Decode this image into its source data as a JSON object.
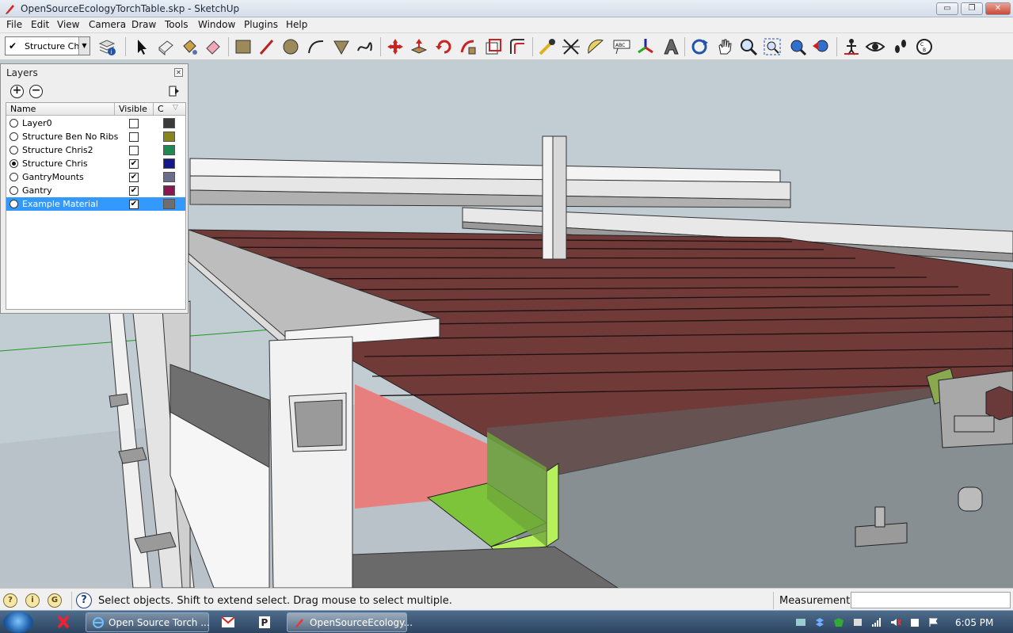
{
  "window": {
    "title": "OpenSourceEcologyTorchTable.skp - SketchUp",
    "minimize_label": "▭",
    "restore_label": "❐",
    "close_label": "✕"
  },
  "menu": [
    "File",
    "Edit",
    "View",
    "Camera",
    "Draw",
    "Tools",
    "Window",
    "Plugins",
    "Help"
  ],
  "toolbar": {
    "layer_dropdown_value": "Structure Chris",
    "layer_check": "✔",
    "tools": [
      "layer-manager-icon",
      "select-icon",
      "make-component-icon",
      "paint-bucket-icon",
      "eraser-icon",
      "rectangle-icon",
      "line-icon",
      "circle-icon",
      "arc-icon",
      "polygon-icon",
      "freehand-icon",
      "move-icon",
      "push-pull-icon",
      "rotate-icon",
      "follow-me-icon",
      "scale-icon",
      "offset-icon",
      "tape-measure-icon",
      "dimension-icon",
      "protractor-icon",
      "text-icon",
      "axes-icon",
      "3d-text-icon",
      "orbit-icon",
      "pan-icon",
      "zoom-icon",
      "zoom-window-icon",
      "zoom-extents-icon",
      "previous-view-icon",
      "position-camera-icon",
      "look-around-icon",
      "walk-icon",
      "section-plane-icon"
    ]
  },
  "layers_panel": {
    "title": "Layers",
    "close_label": "✕",
    "add_label": "+",
    "remove_label": "−",
    "columns": {
      "name": "Name",
      "visible": "Visible",
      "color": "C"
    },
    "layers": [
      {
        "name": "Layer0",
        "active": false,
        "visible": false,
        "color": "#3a3a3a"
      },
      {
        "name": "Structure Ben No Ribs",
        "active": false,
        "visible": false,
        "color": "#86841a"
      },
      {
        "name": "Structure Chris2",
        "active": false,
        "visible": false,
        "color": "#1d8a55"
      },
      {
        "name": "Structure Chris",
        "active": true,
        "visible": true,
        "color": "#16188a"
      },
      {
        "name": "GantryMounts",
        "active": false,
        "visible": true,
        "color": "#6c6c8c"
      },
      {
        "name": "Gantry",
        "active": false,
        "visible": true,
        "color": "#8a1850"
      },
      {
        "name": "Example Material",
        "active": false,
        "visible": true,
        "color": "#6e6e6e",
        "selected": true
      }
    ],
    "check_mark": "✔"
  },
  "statusbar": {
    "status_text": "Select objects. Shift to extend select. Drag mouse to select multiple.",
    "measurements_label": "Measurements",
    "measurements_value": "",
    "help_icon_label": "?"
  },
  "taskbar": {
    "buttons": [
      {
        "label": "Open Source Torch ..."
      },
      {
        "label": "OpenSourceEcology..."
      }
    ],
    "clock": "6:05 PM"
  }
}
